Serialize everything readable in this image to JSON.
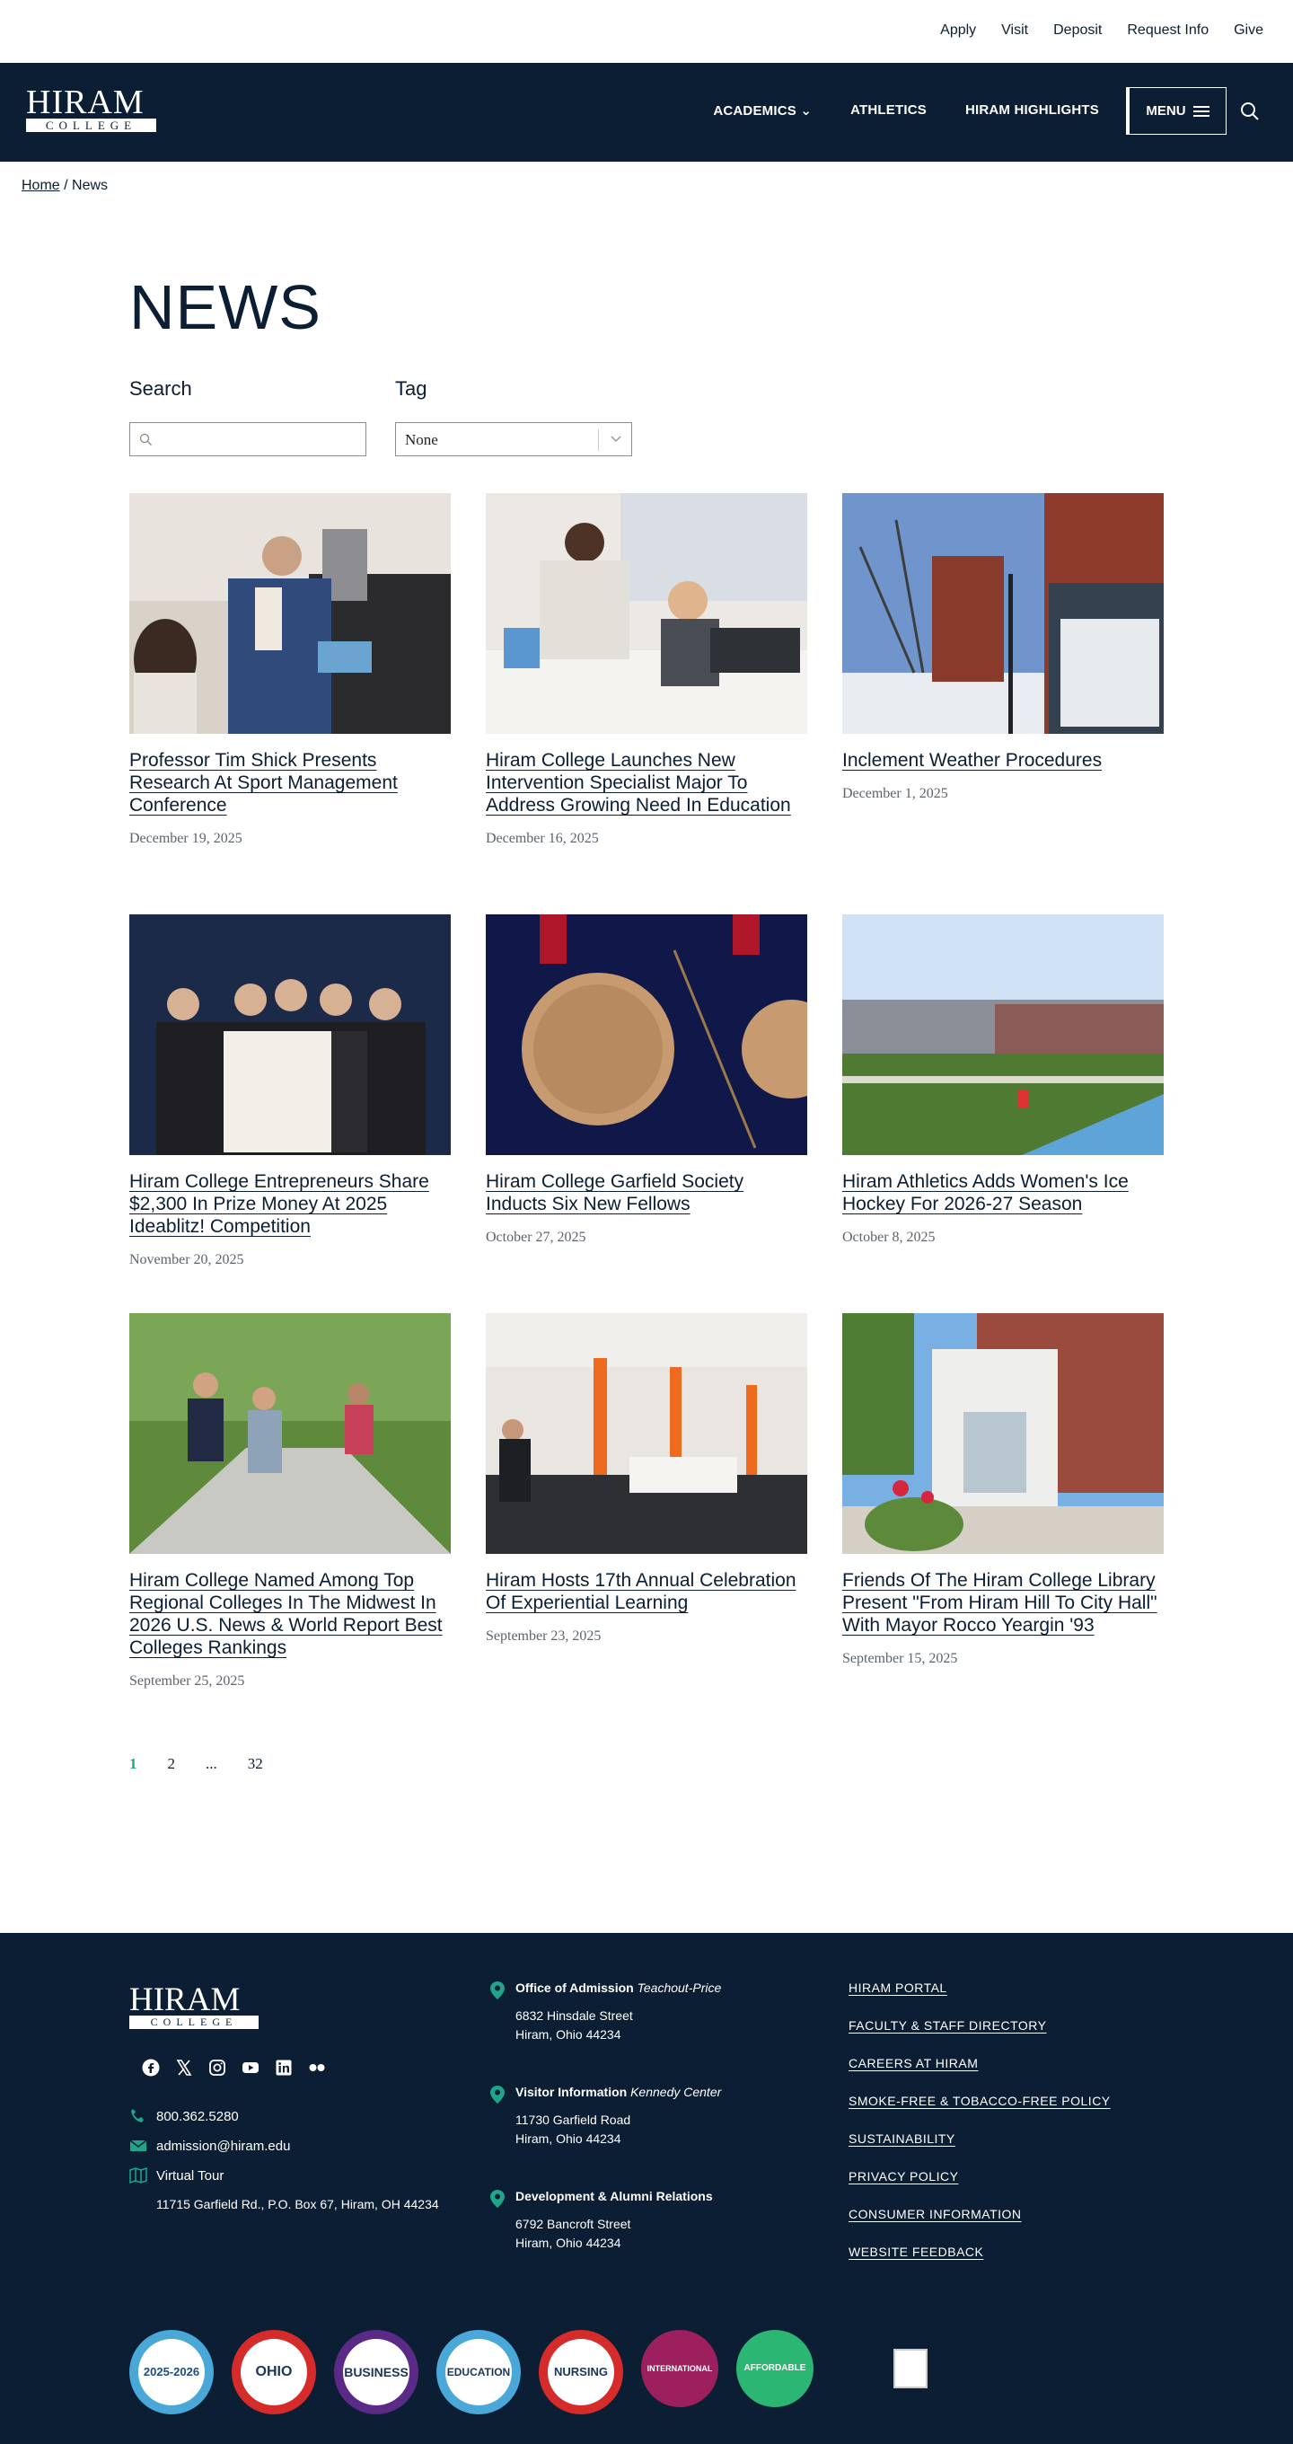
{
  "utility_nav": [
    "Apply",
    "Visit",
    "Deposit",
    "Request Info",
    "Give"
  ],
  "logo": {
    "line1": "HIRAM",
    "line2": "COLLEGE"
  },
  "main_nav": [
    {
      "label": "ACADEMICS",
      "has_dropdown": true
    },
    {
      "label": "ATHLETICS",
      "has_dropdown": false
    },
    {
      "label": "HIRAM HIGHLIGHTS",
      "has_dropdown": false
    }
  ],
  "menu_label": "MENU",
  "breadcrumb": {
    "home": "Home",
    "separator": "/",
    "current": "News"
  },
  "page_title": "NEWS",
  "filters": {
    "search_label": "Search",
    "search_value": "",
    "tag_label": "Tag",
    "tag_value": "None"
  },
  "articles": [
    {
      "title": "Professor Tim Shick Presents Research At Sport Management Conference",
      "date": "December 19, 2025"
    },
    {
      "title": "Hiram College Launches New Intervention Specialist Major To Address Growing Need In Education",
      "date": "December 16, 2025"
    },
    {
      "title": "Inclement Weather Procedures",
      "date": "December 1, 2025"
    },
    {
      "title": "Hiram College Entrepreneurs Share $2,300 In Prize Money At 2025 Ideablitz! Competition",
      "date": "November 20, 2025"
    },
    {
      "title": "Hiram College Garfield Society Inducts Six New Fellows",
      "date": "October 27, 2025"
    },
    {
      "title": "Hiram Athletics Adds Women's Ice Hockey For 2026-27 Season",
      "date": "October 8, 2025"
    },
    {
      "title": "Hiram College Named Among Top Regional Colleges In The Midwest In 2026 U.S. News & World Report Best Colleges Rankings",
      "date": "September 25, 2025"
    },
    {
      "title": "Hiram Hosts 17th Annual Celebration Of Experiential Learning",
      "date": "September 23, 2025"
    },
    {
      "title": "Friends Of The Hiram College Library Present \"From Hiram Hill To City Hall\" With Mayor Rocco Yeargin '93",
      "date": "September 15, 2025"
    }
  ],
  "pagination": {
    "current": "1",
    "next": "2",
    "ellipsis": "...",
    "last": "32"
  },
  "footer": {
    "phone": "800.362.5280",
    "email": "admission@hiram.edu",
    "tour": "Virtual Tour",
    "address": "11715 Garfield Rd., P.O. Box 67, Hiram, OH 44234",
    "offices": [
      {
        "name": "Office of Admission",
        "place": "Teachout-Price",
        "street": "6832 Hinsdale Street",
        "city": "Hiram, Ohio 44234"
      },
      {
        "name": "Visitor Information",
        "place": "Kennedy Center",
        "street": "11730 Garfield Road",
        "city": "Hiram, Ohio 44234"
      },
      {
        "name": "Development & Alumni Relations",
        "place": "",
        "street": "6792 Bancroft Street",
        "city": "Hiram, Ohio 44234"
      }
    ],
    "links": [
      "HIRAM PORTAL",
      "FACULTY & STAFF DIRECTORY",
      "CAREERS AT HIRAM",
      "SMOKE-FREE & TOBACCO-FREE POLICY",
      "SUSTAINABILITY",
      "PRIVACY POLICY",
      "CONSUMER INFORMATION",
      "WEBSITE FEEDBACK"
    ],
    "badges": [
      {
        "label": "2025-2026",
        "ring": "#4aa8d8"
      },
      {
        "label": "OHIO",
        "ring": "#d52b2b"
      },
      {
        "label": "BUSINESS",
        "ring": "#5a2a86"
      },
      {
        "label": "EDUCATION",
        "ring": "#4aa8d8"
      },
      {
        "label": "NURSING",
        "ring": "#d52b2b"
      },
      {
        "label": "INTERNATIONAL",
        "ring": "#9c1f5e"
      },
      {
        "label": "AFFORDABLE",
        "ring": "#2bb673"
      }
    ],
    "social_icons": [
      "facebook-icon",
      "x-icon",
      "instagram-icon",
      "youtube-icon",
      "linkedin-icon",
      "flickr-icon"
    ]
  },
  "colors": {
    "navy": "#0b1e33",
    "accent": "#1fa58a",
    "white": "#ffffff"
  }
}
